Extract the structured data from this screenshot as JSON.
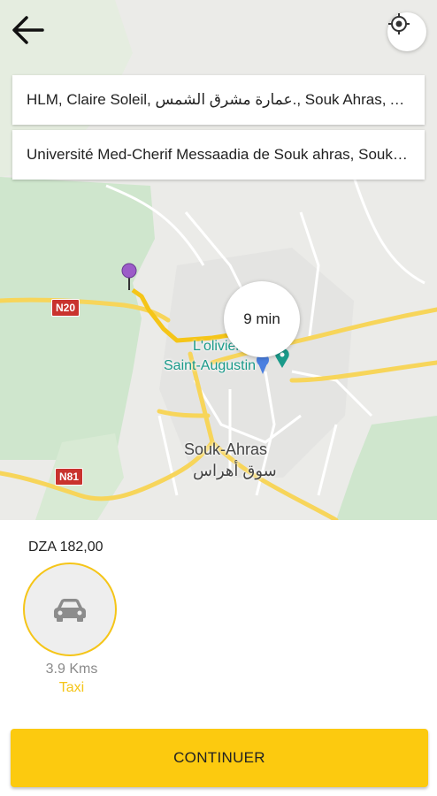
{
  "pickup": {
    "address": "HLM, Claire Soleil, عمارة مشرق الشمس., Souk Ahras, Algeria"
  },
  "dropoff": {
    "address": "Université Med-Cherif Messaadia de Souk ahras, Souk Ahras"
  },
  "map": {
    "eta": "9 min",
    "place_label_line1": "L'olivier",
    "place_label_line2": "Saint-Augustin",
    "city_label": "Souk-Ahras",
    "city_label_ar": "سوق أهراس",
    "road_n20": "N20",
    "road_n81": "N81",
    "route_color": "#f5c518",
    "water_color": "#a6d4f2",
    "park_color": "#c5e0c5"
  },
  "ride": {
    "price": "DZA 182,00",
    "distance": "3.9 Kms",
    "vehicle_type": "Taxi",
    "vehicle_icon": "car-icon"
  },
  "actions": {
    "continue_label": "CONTINUER"
  },
  "colors": {
    "accent": "#fcca0f",
    "pin_pickup": "#9c5cc8",
    "pin_dropoff": "#4a7fe0"
  }
}
